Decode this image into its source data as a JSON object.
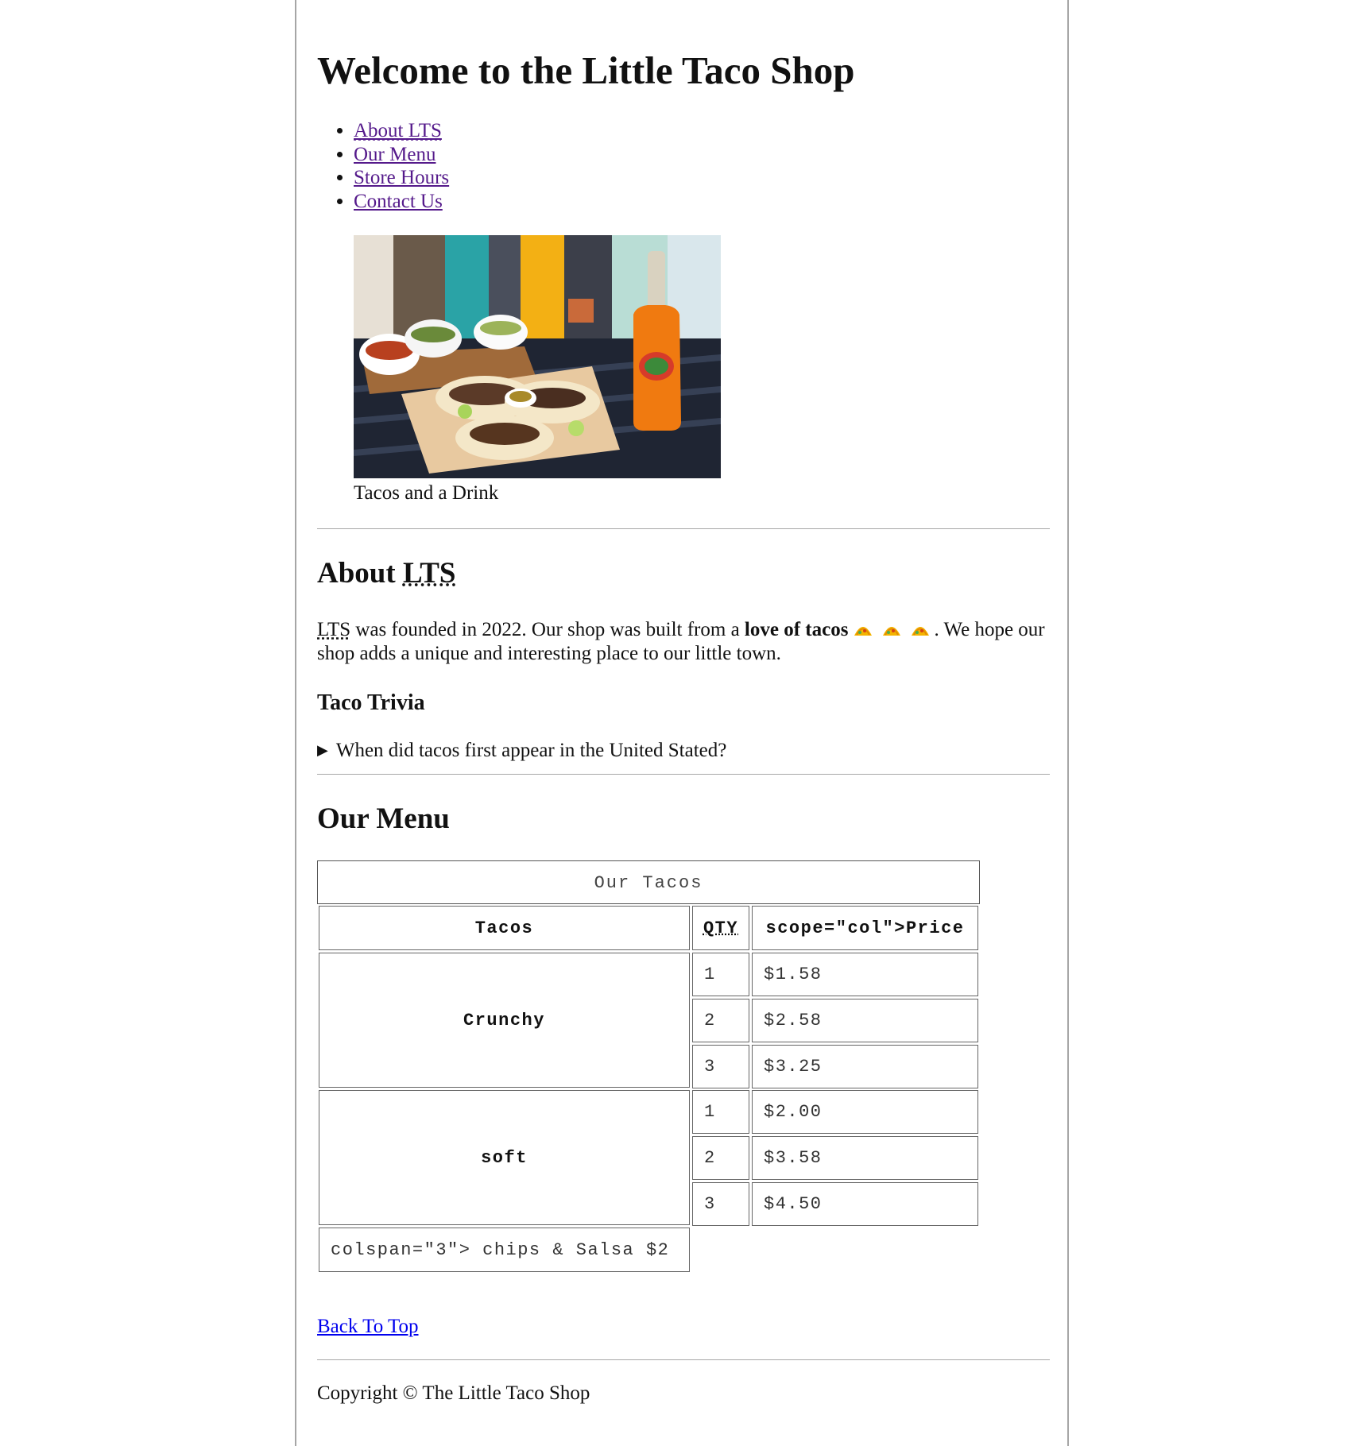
{
  "header": {
    "title": "Welcome to the Little Taco Shop"
  },
  "nav": {
    "items": [
      {
        "label": "About LTS"
      },
      {
        "label": "Our Menu"
      },
      {
        "label": "Store Hours"
      },
      {
        "label": "Contact Us"
      }
    ]
  },
  "figure": {
    "caption": "Tacos and a Drink"
  },
  "about": {
    "heading_prefix": "About ",
    "heading_abbr": "LTS",
    "para_abbr": "LTS",
    "para_text_1": " was founded in 2022. Our shop was built from a ",
    "para_bold": "love of tacos",
    "para_text_2": ". We hope our shop adds a unique and interesting place to our little town.",
    "trivia_heading": "Taco Trivia",
    "trivia_question": "When did tacos first appear in the United Stated?"
  },
  "menu": {
    "heading": "Our Menu",
    "table_caption": "Our Tacos",
    "headers": [
      "Tacos",
      "QTY",
      "scope=\"col\">Price"
    ],
    "groups": [
      {
        "name": "Crunchy",
        "rows": [
          {
            "qty": "1",
            "price": "$1.58"
          },
          {
            "qty": "2",
            "price": "$2.58"
          },
          {
            "qty": "3",
            "price": "$3.25"
          }
        ]
      },
      {
        "name": "soft",
        "rows": [
          {
            "qty": "1",
            "price": "$2.00"
          },
          {
            "qty": "2",
            "price": "$3.58"
          },
          {
            "qty": "3",
            "price": "$4.50"
          }
        ]
      }
    ],
    "footer_cell": "colspan=\"3\"> chips & Salsa $2"
  },
  "back_to_top": "Back To Top",
  "footer": {
    "copyright": "Copyright © The Little Taco Shop"
  },
  "colors": {
    "visited_link": "#551a8b",
    "link": "#0000ee"
  }
}
